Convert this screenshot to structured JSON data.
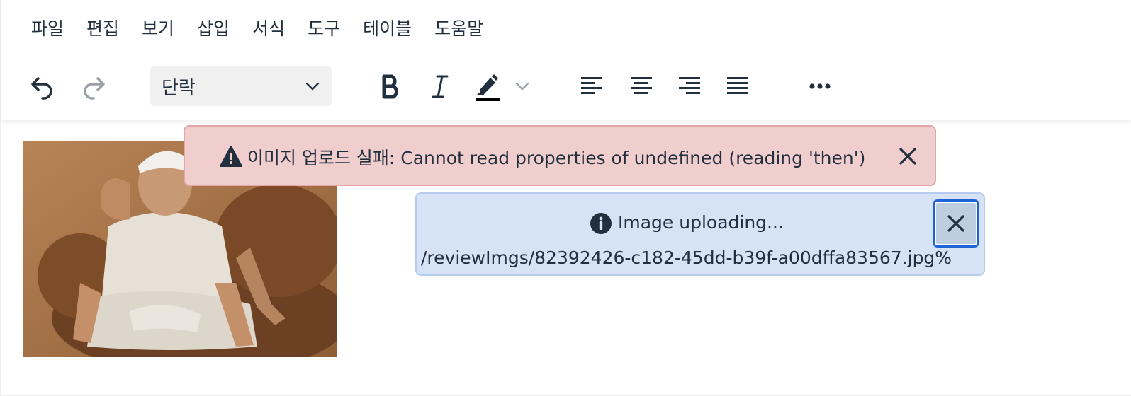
{
  "menubar": {
    "items": [
      "파일",
      "편집",
      "보기",
      "삽입",
      "서식",
      "도구",
      "테이블",
      "도움말"
    ]
  },
  "toolbar": {
    "undo_icon": "undo-icon",
    "redo_icon": "redo-icon",
    "block_format": "단락",
    "bold_icon": "bold-icon",
    "italic_icon": "italic-icon",
    "highlight_icon": "highlight-color-icon",
    "align_left_icon": "align-left-icon",
    "align_center_icon": "align-center-icon",
    "align_right_icon": "align-right-icon",
    "align_justify_icon": "align-justify-icon",
    "more_icon": "more-icon"
  },
  "notifications": {
    "error": {
      "message": "이미지 업로드 실패: Cannot read properties of undefined (reading 'then')",
      "icon": "warning-icon"
    },
    "info": {
      "message": "Image uploading...",
      "path": "/reviewImgs/82392426-c182-45dd-b39f-a00dffa83567.jpg%",
      "icon": "info-icon"
    }
  },
  "colors": {
    "error_bg": "#f0cece",
    "info_bg": "#d6e3f6",
    "focus_ring": "#1f63d6",
    "text": "#222f3e"
  }
}
